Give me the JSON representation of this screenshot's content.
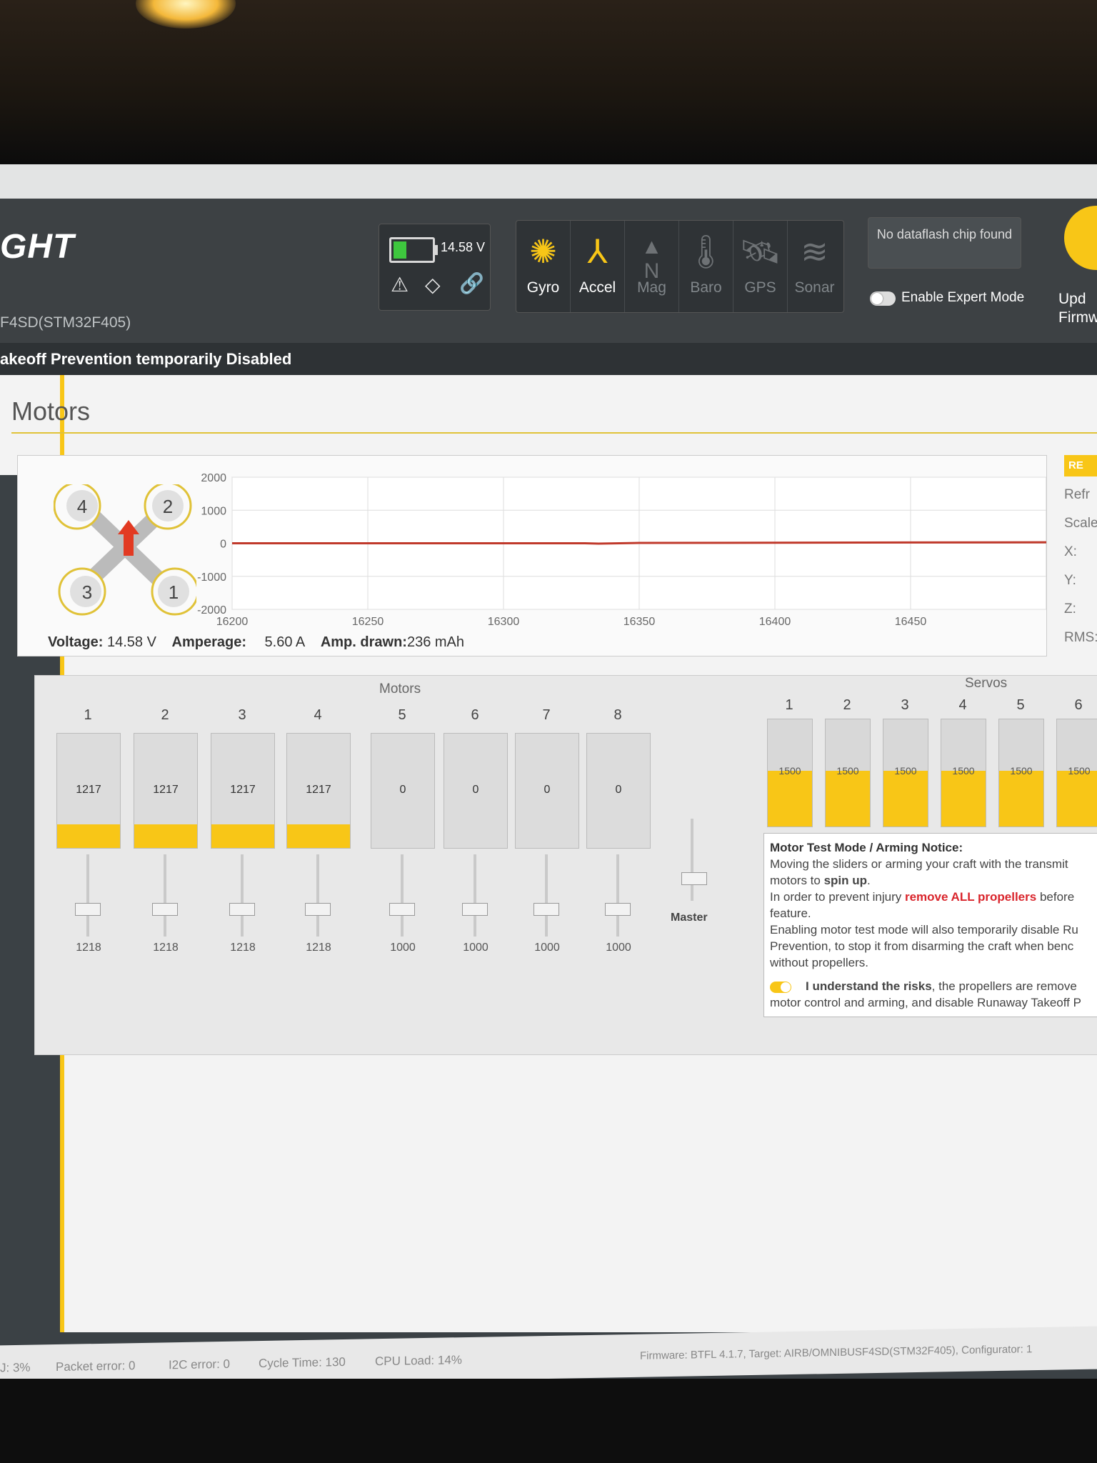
{
  "header": {
    "logo": "GHT",
    "board": "F4SD(STM32F405)",
    "warning": "akeoff Prevention temporarily Disabled",
    "battery_voltage": "14.58 V",
    "sensors": [
      {
        "label": "Gyro",
        "icon": "gyro-icon",
        "active": true
      },
      {
        "label": "Accel",
        "icon": "accel-icon",
        "active": true
      },
      {
        "label": "Mag",
        "icon": "mag-icon",
        "active": false
      },
      {
        "label": "Baro",
        "icon": "baro-icon",
        "active": false
      },
      {
        "label": "GPS",
        "icon": "gps-icon",
        "active": false
      },
      {
        "label": "Sonar",
        "icon": "sonar-icon",
        "active": false
      }
    ],
    "dataflash": "No dataflash chip found",
    "expert_mode": "Enable Expert Mode",
    "update_firmware": "Upd\nFirmw"
  },
  "page": {
    "title": "Motors"
  },
  "quad": {
    "motor_labels": [
      "4",
      "2",
      "3",
      "1"
    ]
  },
  "chart_data": {
    "type": "line",
    "y_ticks": [
      "2000",
      "1000",
      "0",
      "-1000",
      "-2000"
    ],
    "x_ticks": [
      "16200",
      "16250",
      "16300",
      "16350",
      "16400",
      "16450"
    ],
    "ylim": [
      -2000,
      2000
    ],
    "xlim": [
      16200,
      16500
    ],
    "series": [
      {
        "x": [
          16200,
          16330,
          16335,
          16350,
          16500
        ],
        "y": [
          0,
          0,
          -10,
          10,
          30
        ]
      }
    ],
    "grid": true
  },
  "side_panel": {
    "reset": "RE",
    "rows": [
      "Refr",
      "Scale",
      "X:",
      "Y:",
      "Z:",
      "RMS:"
    ]
  },
  "status": {
    "voltage_label": "Voltage:",
    "voltage_value": "14.58 V",
    "amperage_label": "Amperage:",
    "amperage_value": "5.60 A",
    "drawn_label": "Amp. drawn:",
    "drawn_value": "236 mAh"
  },
  "motors": {
    "group_label": "Motors",
    "items": [
      {
        "num": "1",
        "value": "1217",
        "slider": "1218",
        "level": 0.217
      },
      {
        "num": "2",
        "value": "1217",
        "slider": "1218",
        "level": 0.217
      },
      {
        "num": "3",
        "value": "1217",
        "slider": "1218",
        "level": 0.217
      },
      {
        "num": "4",
        "value": "1217",
        "slider": "1218",
        "level": 0.217
      },
      {
        "num": "5",
        "value": "0",
        "slider": "1000",
        "level": 0
      },
      {
        "num": "6",
        "value": "0",
        "slider": "1000",
        "level": 0
      },
      {
        "num": "7",
        "value": "0",
        "slider": "1000",
        "level": 0
      },
      {
        "num": "8",
        "value": "0",
        "slider": "1000",
        "level": 0
      }
    ],
    "master_label": "Master"
  },
  "servos": {
    "group_label": "Servos",
    "items": [
      {
        "num": "1",
        "value": "1500"
      },
      {
        "num": "2",
        "value": "1500"
      },
      {
        "num": "3",
        "value": "1500"
      },
      {
        "num": "4",
        "value": "1500"
      },
      {
        "num": "5",
        "value": "1500"
      },
      {
        "num": "6",
        "value": "1500"
      }
    ]
  },
  "notice": {
    "title": "Motor Test Mode / Arming Notice:",
    "line1a": "Moving the sliders or arming your craft with the transmit",
    "line1b": "motors to ",
    "spin_up": "spin up",
    "line2a": "In order to prevent injury ",
    "remove": "remove ALL propellers",
    "line2b": " before",
    "line2c": "feature.",
    "line3": "Enabling motor test mode will also temporarily disable Ru",
    "line4": "Prevention, to stop it from disarming the craft when benc",
    "line5": "without propellers.",
    "understand_bold": "I understand the risks",
    "understand_rest": ", the propellers are remove",
    "understand_line2": "motor control and arming, and disable Runaway Takeoff P"
  },
  "footer": {
    "items": [
      "J: 3%",
      "Packet error: 0",
      "I2C error: 0",
      "Cycle Time: 130",
      "CPU Load: 14%"
    ],
    "firmware": "Firmware: BTFL 4.1.7, Target: AIRB/OMNIBUSF4SD(STM32F405), Configurator: 1"
  }
}
